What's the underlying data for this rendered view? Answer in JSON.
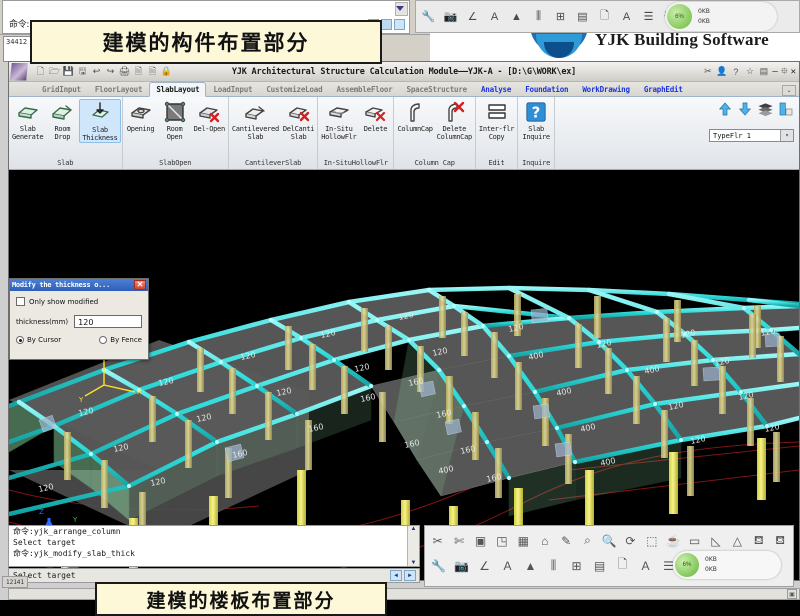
{
  "background_window": {
    "command_prefix": "命令:",
    "number_box": "34412",
    "brand_text": "YJK Building Software"
  },
  "callouts": {
    "top": "建模的构件布置部分",
    "bottom": "建模的楼板布置部分"
  },
  "titlebar": {
    "title": "YJK Architectural Structure Calculation Module——YJK-A - [D:\\G\\WORK\\ex]",
    "quick_access": [
      {
        "name": "new-icon",
        "glyph": "🗋"
      },
      {
        "name": "open-icon",
        "glyph": "🗁"
      },
      {
        "name": "save-icon",
        "glyph": "💾"
      },
      {
        "name": "save-as-icon",
        "glyph": "🖫"
      },
      {
        "name": "undo-icon",
        "glyph": "↩"
      },
      {
        "name": "redo-icon",
        "glyph": "↪"
      },
      {
        "name": "print-icon",
        "glyph": "🖨"
      },
      {
        "name": "export-icon",
        "glyph": "🗎"
      },
      {
        "name": "import-icon",
        "glyph": "🗎"
      },
      {
        "name": "lock-icon",
        "glyph": "🔒"
      }
    ],
    "right_icons": [
      {
        "name": "scissors-icon",
        "glyph": "✂"
      },
      {
        "name": "user-icon",
        "glyph": "👤"
      },
      {
        "name": "help-icon",
        "glyph": "?"
      },
      {
        "name": "favorite-icon",
        "glyph": "☆"
      },
      {
        "name": "window-icon",
        "glyph": "▤"
      }
    ],
    "window_buttons": [
      "–",
      "⯐",
      "✕"
    ]
  },
  "tabs": [
    {
      "label": "GridInput",
      "state": "normal"
    },
    {
      "label": "FloorLayout",
      "state": "normal"
    },
    {
      "label": "SlabLayout",
      "state": "active"
    },
    {
      "label": "LoadInput",
      "state": "normal"
    },
    {
      "label": "CustomizeLoad",
      "state": "normal"
    },
    {
      "label": "AssembleFloor",
      "state": "normal"
    },
    {
      "label": "SpaceStructure",
      "state": "normal"
    },
    {
      "label": "Analyse",
      "state": "blue"
    },
    {
      "label": "Foundation",
      "state": "blue"
    },
    {
      "label": "WorkDrawing",
      "state": "blue"
    },
    {
      "label": "GraphEdit",
      "state": "blue"
    }
  ],
  "ribbon": {
    "groups": [
      {
        "label": "Slab",
        "buttons": [
          {
            "label": "Slab\nGenerate",
            "icon": "slab-generate-icon",
            "selected": false
          },
          {
            "label": "Room\nDrop",
            "icon": "room-drop-icon",
            "selected": false
          },
          {
            "label": "Slab\nThickness",
            "icon": "slab-thickness-icon",
            "selected": true
          }
        ]
      },
      {
        "label": "SlabOpen",
        "buttons": [
          {
            "label": "Opening",
            "icon": "opening-icon",
            "selected": false
          },
          {
            "label": "Room\nOpen",
            "icon": "room-open-icon",
            "selected": false
          },
          {
            "label": "Del-Open",
            "icon": "delete-opening-icon",
            "selected": false
          }
        ]
      },
      {
        "label": "CantileverSlab",
        "buttons": [
          {
            "label": "Cantilevered\nSlab",
            "icon": "cantilevered-slab-icon",
            "selected": false
          },
          {
            "label": "DelCanti\nSlab",
            "icon": "delete-cantilever-slab-icon",
            "selected": false
          }
        ]
      },
      {
        "label": "In-SituHollowFlr",
        "buttons": [
          {
            "label": "In-Situ\nHollowFlr",
            "icon": "in-situ-hollow-floor-icon",
            "selected": false
          },
          {
            "label": "Delete",
            "icon": "delete-hollow-floor-icon",
            "selected": false
          }
        ]
      },
      {
        "label": "Column Cap",
        "buttons": [
          {
            "label": "ColumnCap",
            "icon": "column-cap-icon",
            "selected": false
          },
          {
            "label": "Delete\nColumnCap",
            "icon": "delete-column-cap-icon",
            "selected": false
          }
        ]
      },
      {
        "label": "Edit",
        "buttons": [
          {
            "label": "Inter-flr\nCopy",
            "icon": "inter-floor-copy-icon",
            "selected": false
          }
        ]
      },
      {
        "label": "Inquire",
        "buttons": [
          {
            "label": "Slab\nInquire",
            "icon": "slab-inquire-icon",
            "selected": false
          }
        ]
      }
    ],
    "nav_icons": [
      {
        "name": "up-floor-icon",
        "glyph": "⬆"
      },
      {
        "name": "down-floor-icon",
        "glyph": "⬇"
      },
      {
        "name": "all-floors-icon",
        "glyph": "▤"
      },
      {
        "name": "floor-view-icon",
        "glyph": "◰"
      }
    ],
    "floor_select": {
      "value": "TypeFlr 1",
      "arrow": "▾"
    }
  },
  "dialog": {
    "title": "Modify the thickness o...",
    "close": "✕",
    "checkbox_label": "Only show modified",
    "checkbox_checked": false,
    "field_label": "thickness(mm)",
    "field_value": "120",
    "radio_cursor": "By Cursor",
    "radio_fence": "By Fence",
    "radio_selected": "By Cursor"
  },
  "viewport": {
    "slab_thickness_labels": [
      "120",
      "120",
      "120",
      "120",
      "120",
      "120",
      "120",
      "120",
      "120",
      "120",
      "120",
      "120",
      "160",
      "160",
      "160",
      "160",
      "160",
      "160",
      "160",
      "160",
      "400",
      "400",
      "400",
      "400",
      "400",
      "400"
    ],
    "ucs_axes": [
      "X",
      "Y",
      "Z"
    ],
    "triad_axes": [
      "X",
      "Y",
      "Z"
    ],
    "colors": {
      "background": "#000000",
      "beam": "#3fe6e6",
      "column": "#d6cf84",
      "slab": "#5a5a5a",
      "wall": "#9fd9a8",
      "axis_line": "#8b1a1a",
      "label": "#e8e8e8"
    }
  },
  "command_area": {
    "history": [
      "命令:yjk_arrange_column",
      "Select target",
      "命令:yjk_modify_slab_thick"
    ],
    "prompt": "Select target",
    "scroll_up": "▲",
    "scroll_down": "▼",
    "nav_left": "◄",
    "nav_right": "►"
  },
  "toolbox": {
    "row1": [
      {
        "name": "cut-icon",
        "glyph": "✂"
      },
      {
        "name": "cut-multiple-icon",
        "glyph": "✄"
      },
      {
        "name": "box-3d-icon",
        "glyph": "▣"
      },
      {
        "name": "page-3d-icon",
        "glyph": "◳"
      },
      {
        "name": "solid-box-icon",
        "glyph": "▦"
      },
      {
        "name": "house-icon",
        "glyph": "⌂"
      },
      {
        "name": "paint-icon",
        "glyph": "✎"
      },
      {
        "name": "zoom-in-icon",
        "glyph": "⌕"
      },
      {
        "name": "zoom-icon",
        "glyph": "🔍"
      },
      {
        "name": "zoom-rotate-icon",
        "glyph": "⟳"
      },
      {
        "name": "select-window-icon",
        "glyph": "⬚"
      },
      {
        "name": "teapot-icon",
        "glyph": "☕"
      },
      {
        "name": "ruler-icon",
        "glyph": "▭"
      },
      {
        "name": "angle-icon",
        "glyph": "◺"
      },
      {
        "name": "triangle-icon",
        "glyph": "△"
      },
      {
        "name": "figure-icon",
        "glyph": "⛾"
      },
      {
        "name": "figure-alt-icon",
        "glyph": "⛾"
      }
    ],
    "row2": [
      {
        "name": "wrench-icon",
        "glyph": "🔧"
      },
      {
        "name": "camera-icon",
        "glyph": "📷"
      },
      {
        "name": "angle-measure-icon",
        "glyph": "∠"
      },
      {
        "name": "pdf-icon",
        "glyph": "A"
      },
      {
        "name": "cone-icon",
        "glyph": "▲"
      },
      {
        "name": "columns-icon",
        "glyph": "⫼"
      },
      {
        "name": "grid-edit-icon",
        "glyph": "⊞"
      },
      {
        "name": "delete-layer-icon",
        "glyph": "▤"
      },
      {
        "name": "new-page-icon",
        "glyph": "🗋"
      },
      {
        "name": "text-icon",
        "glyph": "A"
      },
      {
        "name": "list-icon",
        "glyph": "☰"
      },
      {
        "name": "paint-bucket-icon",
        "glyph": "🪣"
      }
    ],
    "cloud": {
      "percent": "6%",
      "up_rate": "0KB",
      "down_rate": "0KB",
      "up_arrow": "↑",
      "down_arrow": "↓"
    }
  },
  "status_bar": {
    "left_number": "12141",
    "indicators": [
      "▣",
      "◴"
    ]
  }
}
